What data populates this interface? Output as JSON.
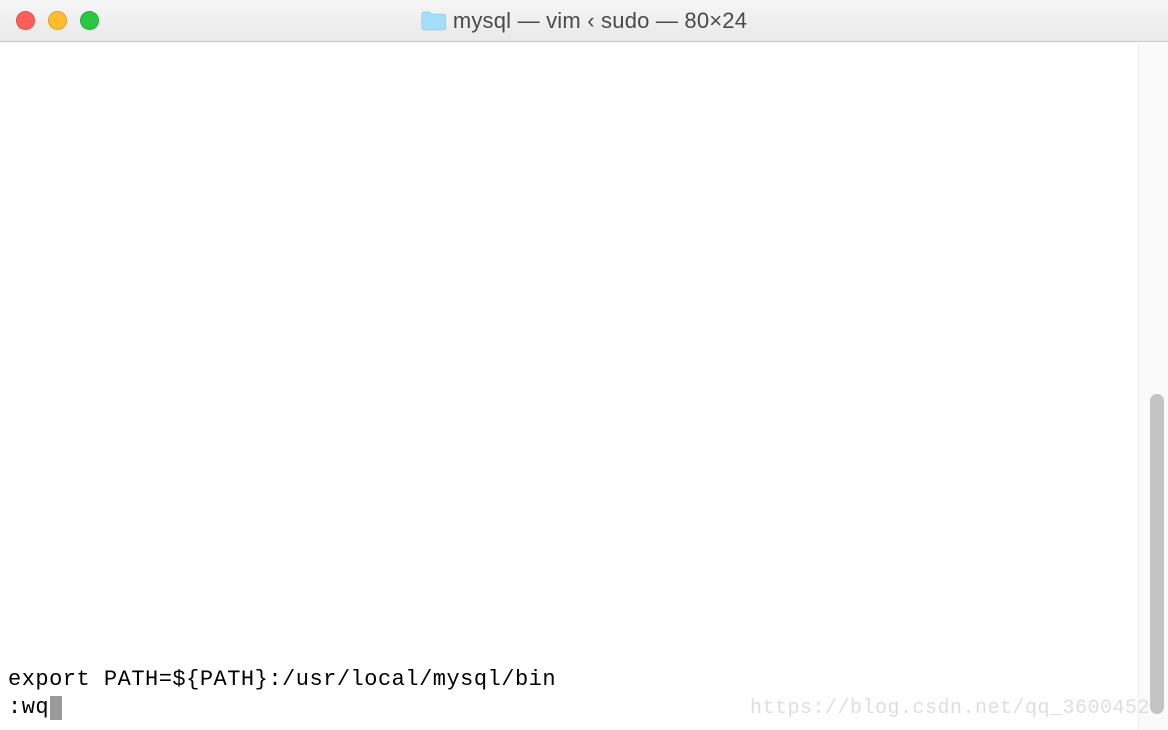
{
  "titlebar": {
    "title_parts": {
      "folder": "mysql",
      "app": "vim",
      "parent": "sudo",
      "size": "80×24"
    },
    "title_full": "mysql — vim ‹ sudo — 80×24"
  },
  "terminal": {
    "content_line": "export PATH=${PATH}:/usr/local/mysql/bin",
    "command_line": ":wq"
  },
  "watermark": "https://blog.csdn.net/qq_3600452",
  "icons": {
    "folder": "folder-icon",
    "settings": "settings-icon"
  }
}
